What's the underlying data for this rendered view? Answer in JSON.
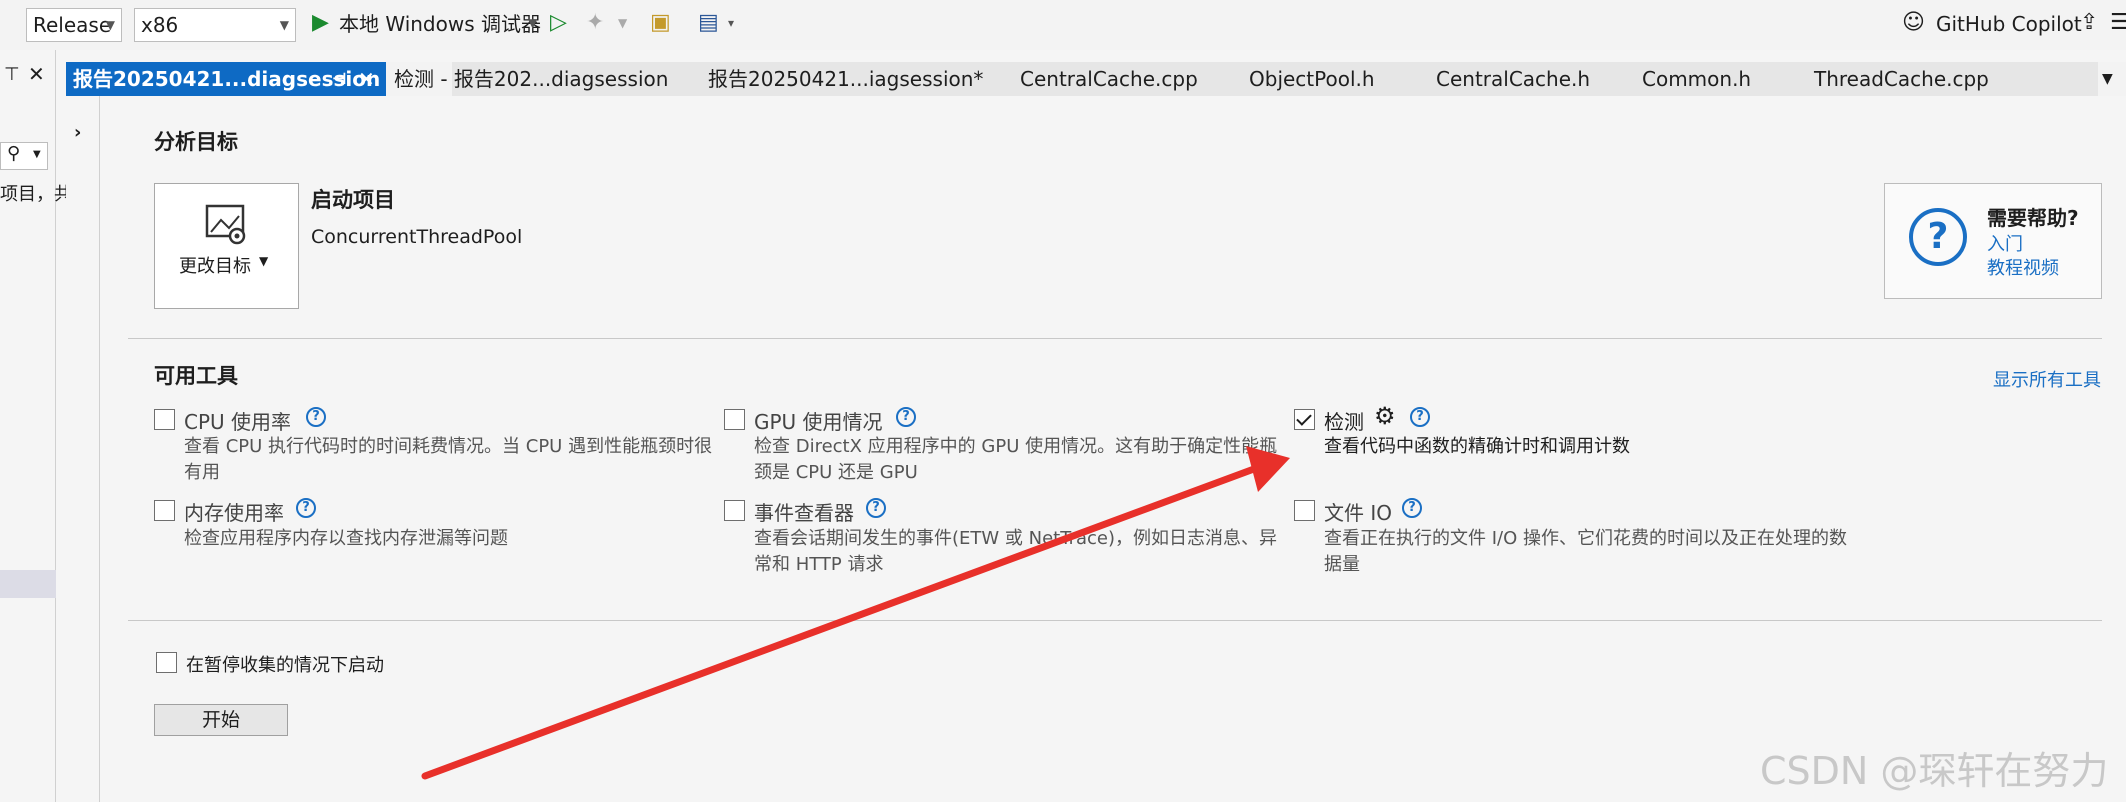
{
  "toolbar": {
    "config": "Release",
    "platform": "x86",
    "debugger": "本地 Windows 调试器",
    "copilot": "GitHub Copilot"
  },
  "left_panel": {
    "snippet": "项目，共"
  },
  "tabs": [
    {
      "label": "报告20250421...diagsession",
      "active": true
    },
    {
      "label": "检测 - 报告202...diagsession"
    },
    {
      "label": "报告20250421...iagsession*"
    },
    {
      "label": "CentralCache.cpp"
    },
    {
      "label": "ObjectPool.h"
    },
    {
      "label": "CentralCache.h"
    },
    {
      "label": "Common.h"
    },
    {
      "label": "ThreadCache.cpp"
    }
  ],
  "target": {
    "section_title": "分析目标",
    "change_target": "更改目标",
    "startup_title": "启动项目",
    "startup_name": "ConcurrentThreadPool"
  },
  "help": {
    "title": "需要帮助?",
    "link1": "入门",
    "link2": "教程视频"
  },
  "tools": {
    "section_title": "可用工具",
    "show_all": "显示所有工具",
    "items": [
      {
        "name": "CPU 使用率",
        "checked": false,
        "desc1": "查看 CPU 执行代码时的时间耗费情况。当 CPU 遇到性能瓶颈时很",
        "desc2": "有用"
      },
      {
        "name": "GPU 使用情况",
        "checked": false,
        "desc1": "检查 DirectX 应用程序中的 GPU 使用情况。这有助于确定性能瓶",
        "desc2": "颈是 CPU 还是 GPU"
      },
      {
        "name": "检测",
        "checked": true,
        "desc1": "查看代码中函数的精确计时和调用计数",
        "desc2": ""
      },
      {
        "name": "内存使用率",
        "checked": false,
        "desc1": "检查应用程序内存以查找内存泄漏等问题",
        "desc2": ""
      },
      {
        "name": "事件查看器",
        "checked": false,
        "desc1": "查看会话期间发生的事件(ETW 或 NetTrace)，例如日志消息、异",
        "desc2": "常和 HTTP 请求"
      },
      {
        "name": "文件 IO",
        "checked": false,
        "desc1": "查看正在执行的文件 I/O 操作、它们花费的时间以及正在处理的数",
        "desc2": "据量"
      }
    ]
  },
  "start": {
    "paused_label": "在暂停收集的情况下启动",
    "start_button": "开始"
  },
  "watermark": "CSDN @琛轩在努力",
  "accent_color": "#0e6ac4",
  "arrow_color": "#e8302a"
}
